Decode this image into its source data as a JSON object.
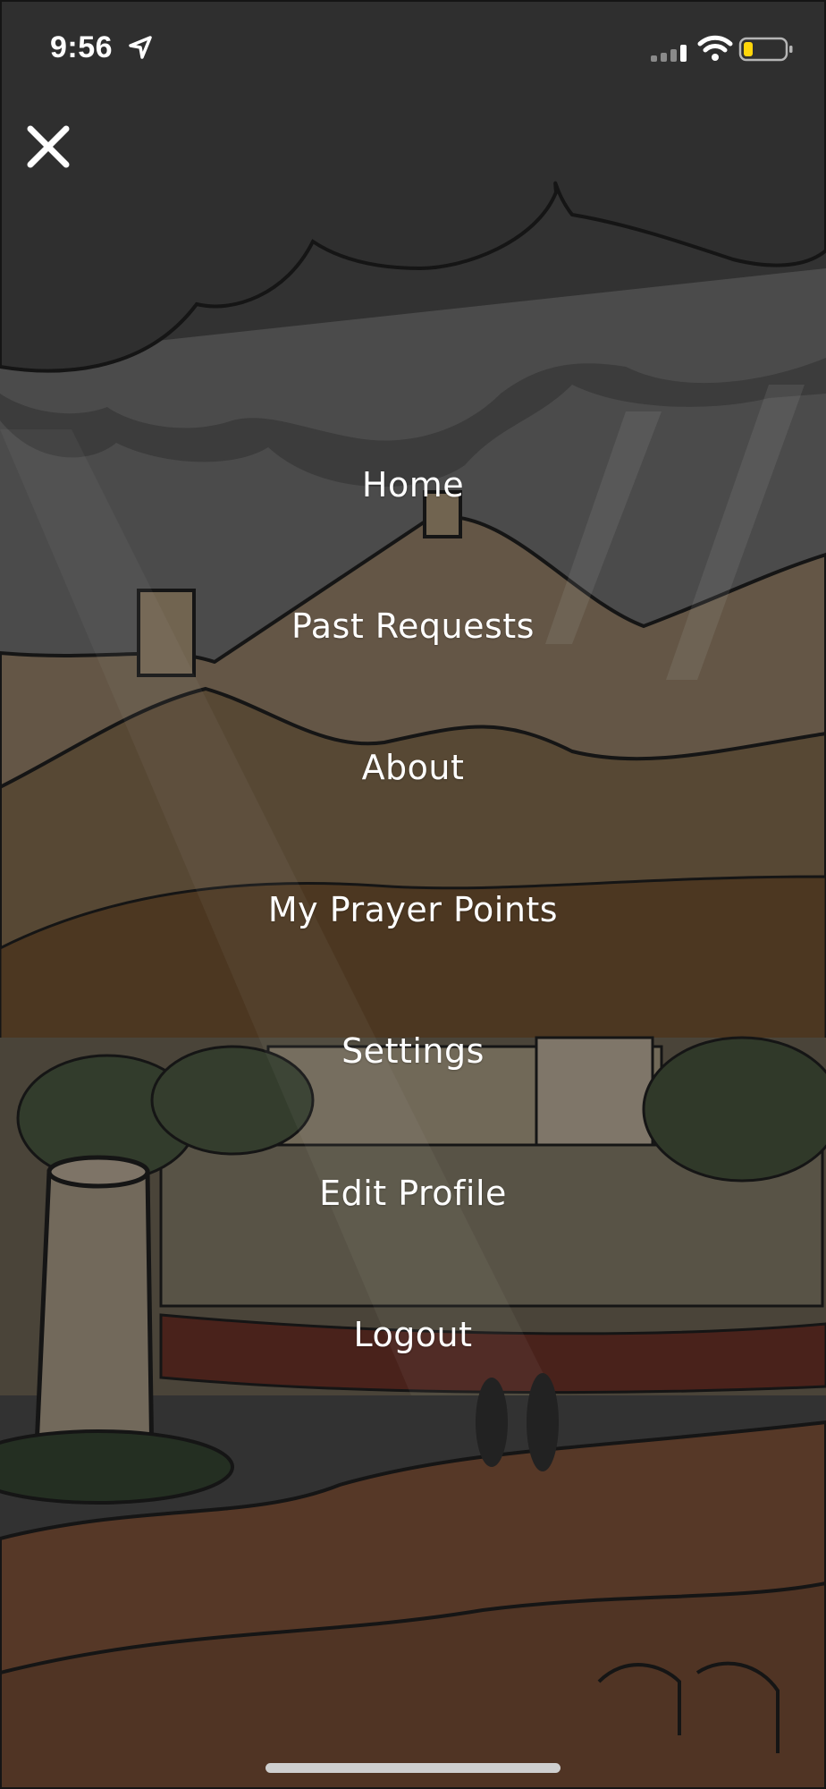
{
  "status_bar": {
    "time": "9:56",
    "icons": [
      "location-arrow-icon",
      "cellular-signal-icon",
      "wifi-icon",
      "battery-low-icon"
    ],
    "battery_color": "#ffd60a"
  },
  "close_icon": "close-icon",
  "menu": {
    "items": [
      {
        "label": "Home"
      },
      {
        "label": "Past Requests"
      },
      {
        "label": "About"
      },
      {
        "label": "My Prayer Points"
      },
      {
        "label": "Settings"
      },
      {
        "label": "Edit Profile"
      },
      {
        "label": "Logout"
      }
    ]
  },
  "colors": {
    "overlay_dark": "#3d3d3d",
    "menu_text": "#ffffff",
    "sand_light": "#8a7a62",
    "sand_dark": "#6a4530"
  }
}
